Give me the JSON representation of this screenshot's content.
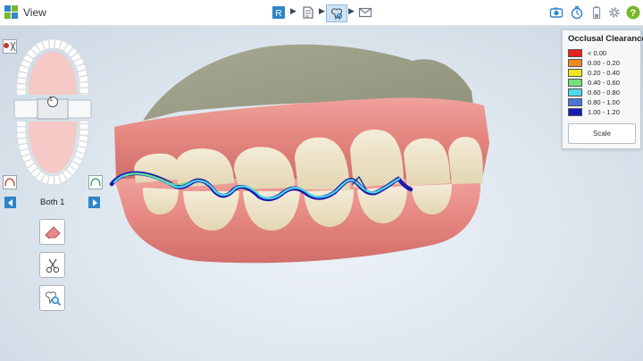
{
  "app": {
    "title": "View",
    "logo_icon": "windows-grid-icon"
  },
  "toolbar": {
    "workflow_steps": [
      {
        "name": "rx",
        "icon": "rx-document-icon",
        "glyph": "R",
        "active": false
      },
      {
        "name": "scan",
        "icon": "scan-icon",
        "active": false
      },
      {
        "name": "view",
        "icon": "view-tooth-icon",
        "active": true
      },
      {
        "name": "send",
        "icon": "envelope-icon",
        "active": false
      }
    ],
    "right_icons": [
      "camera-icon",
      "timer-icon",
      "battery-icon",
      "gear-icon",
      "help-icon"
    ],
    "help_glyph": "?"
  },
  "legend": {
    "title": "Occlusal Clearance",
    "items": [
      {
        "label": "< 0.00",
        "color": "#e8221c"
      },
      {
        "label": "0.00 - 0.20",
        "color": "#f28a1f"
      },
      {
        "label": "0.20 - 0.40",
        "color": "#f2e51c"
      },
      {
        "label": "0.40 - 0.60",
        "color": "#6fe07a"
      },
      {
        "label": "0.60 - 0.80",
        "color": "#4fd8e6"
      },
      {
        "label": "0.80 - 1.00",
        "color": "#4a74d8"
      },
      {
        "label": "1.00 - 1.20",
        "color": "#1a1ab0"
      }
    ],
    "scale_button": "Scale"
  },
  "navigator": {
    "tooth_number": "1",
    "bite_label": "Both 1"
  },
  "tools": [
    "eraser-icon",
    "scissors-icon",
    "tooth-magnifier-icon"
  ],
  "colors": {
    "accent": "#2f86c8",
    "gingiva": "#e98f8c",
    "tooth": "#efe6cf",
    "stone": "#9ea08a"
  }
}
